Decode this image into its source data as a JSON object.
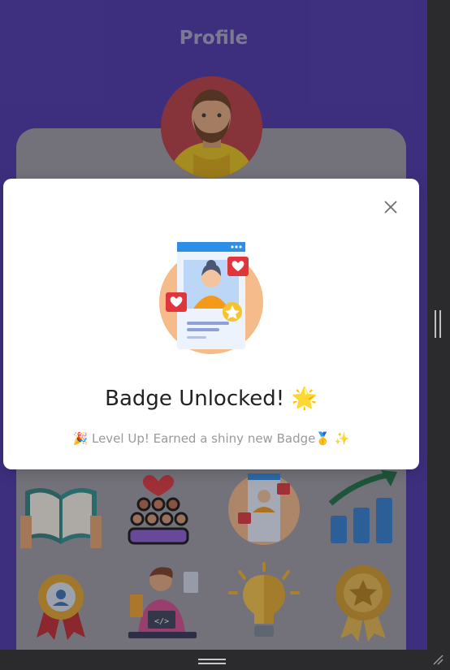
{
  "app": {
    "title": "Profile"
  },
  "modal": {
    "title": "Badge Unlocked! 🌟",
    "subtitle": "🎉 Level Up! Earned a shiny new Badge🥇 ✨",
    "close_icon": "close-icon",
    "illustration_icon": "social-profile-badge-icon"
  },
  "badges": [
    {
      "icon": "open-book-badge-icon"
    },
    {
      "icon": "community-badge-icon"
    },
    {
      "icon": "social-profile-badge-icon"
    },
    {
      "icon": "growth-chart-badge-icon"
    },
    {
      "icon": "gear-award-badge-icon"
    },
    {
      "icon": "developer-badge-icon"
    },
    {
      "icon": "lightbulb-badge-icon"
    },
    {
      "icon": "gold-medal-badge-icon"
    }
  ],
  "colors": {
    "header_bg": "#4a34a8",
    "card_bg": "#9b9aa1",
    "modal_bg": "#ffffff"
  }
}
